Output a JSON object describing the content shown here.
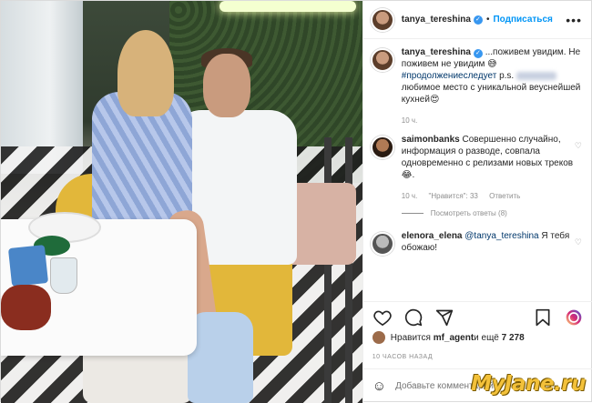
{
  "header": {
    "username": "tanya_tereshina",
    "follow_label": "Подписаться",
    "separator": "•",
    "more_label": "•••"
  },
  "caption": {
    "username": "tanya_tereshina",
    "text_before": " ...поживем увидим. Не поживем не увидим 😅 ",
    "hashtag": "#продолжениеследует",
    "text_after_hashtag": " p.s. ",
    "text_end": " любимое место с уникальной веуснейшей кухней😍",
    "time": "10 ч."
  },
  "comments": [
    {
      "username": "saimonbanks",
      "text": "Совершенно случайно, информация о разводе, совпала одновременно с релизами новых треков 😂.",
      "time": "10 ч.",
      "likes": "\"Нравится\": 33",
      "reply_label": "Ответить",
      "view_replies": "Посмотреть ответы (8)"
    },
    {
      "username": "elenora_elena",
      "mention": "@tanya_tereshina",
      "text": " Я тебя обожаю!"
    }
  ],
  "likes": {
    "prefix": "Нравится ",
    "user": "mf_agent",
    "middle": " и ещё ",
    "count": "7 278"
  },
  "timestamp": "10 ЧАСОВ НАЗАД",
  "comment_input": {
    "placeholder": "Добавьте комментарий..."
  },
  "icons": {
    "verified": "verified-badge-icon",
    "heart": "heart-icon",
    "comment": "comment-icon",
    "share": "share-icon",
    "save": "bookmark-icon",
    "emoji": "emoji-icon",
    "reel": "reel-icon"
  },
  "colors": {
    "accent": "#0095f6",
    "hashtag": "#00376b",
    "muted": "#8e8e8e",
    "watermark": "#f3c13a"
  },
  "watermark": "MyJane.ru"
}
